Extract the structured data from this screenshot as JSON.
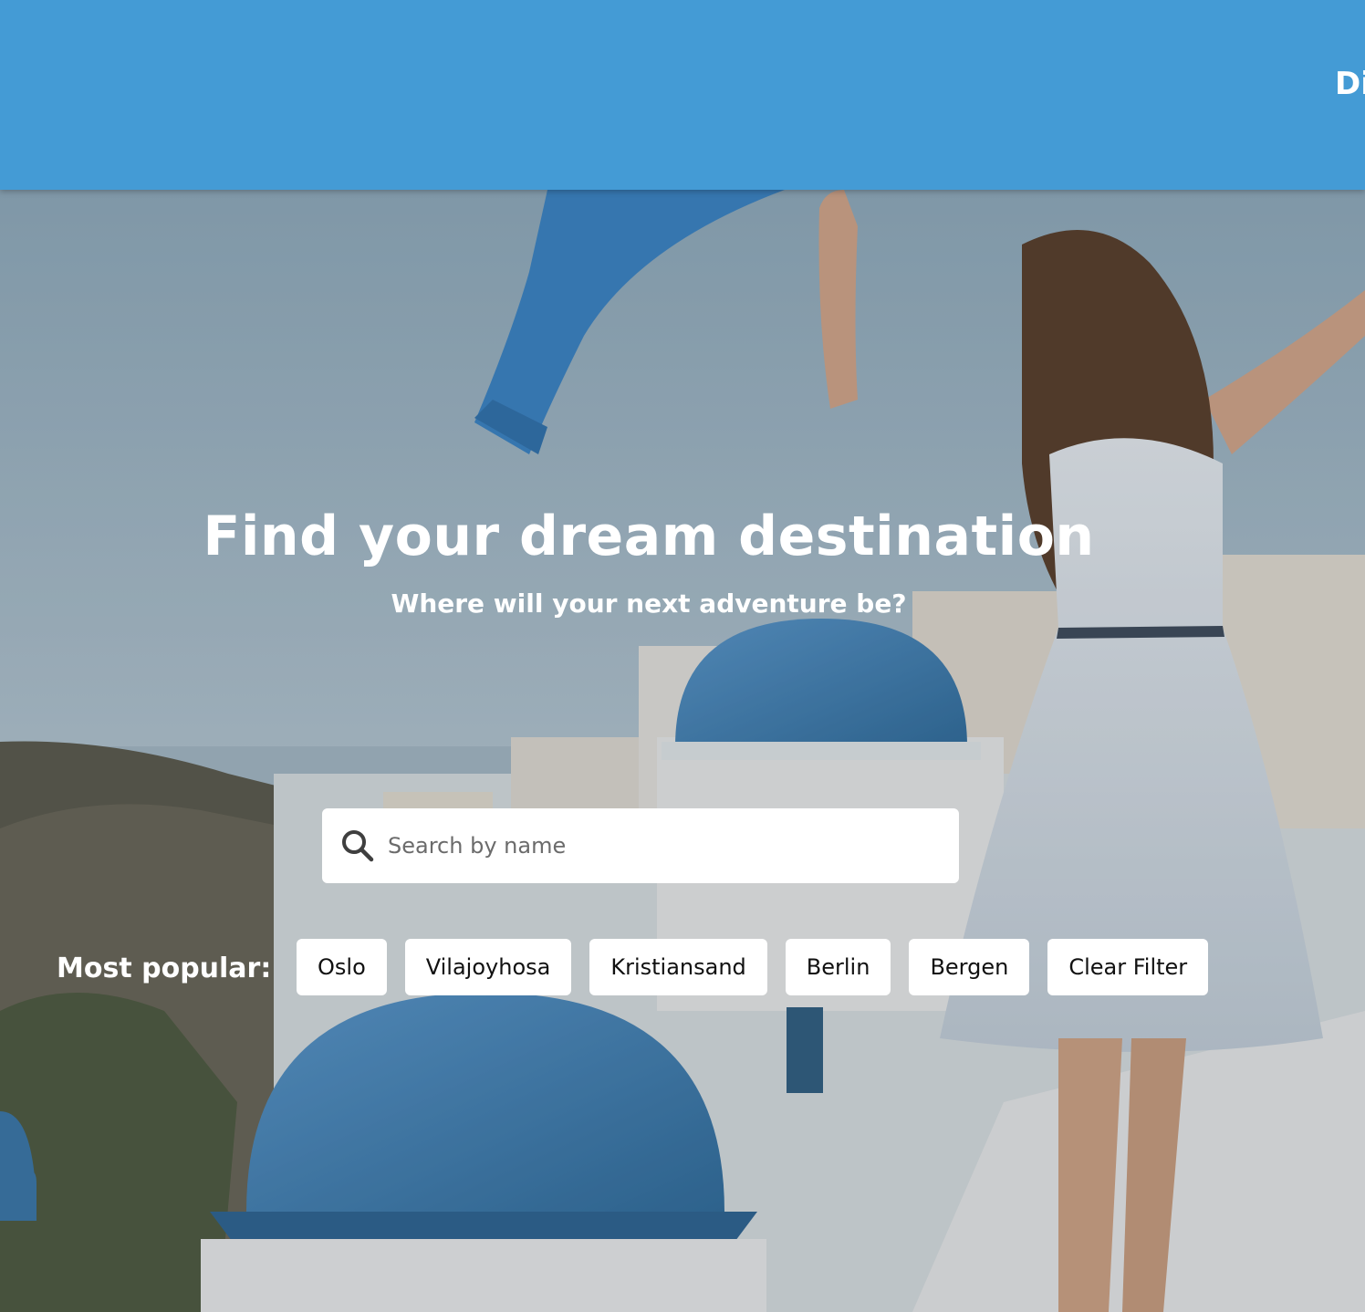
{
  "header": {
    "nav_link": "Di"
  },
  "hero": {
    "title": "Find your dream destination",
    "subtitle": "Where will your next adventure be?",
    "search": {
      "placeholder": "Search by name",
      "value": ""
    },
    "popular_label": "Most popular:",
    "chips": [
      "Oslo",
      "Vilajoyhosa",
      "Kristiansand",
      "Berlin",
      "Bergen"
    ],
    "clear_label": "Clear Filter"
  },
  "colors": {
    "header_bg": "#449bd5",
    "dome_blue": "#3f82b9"
  }
}
